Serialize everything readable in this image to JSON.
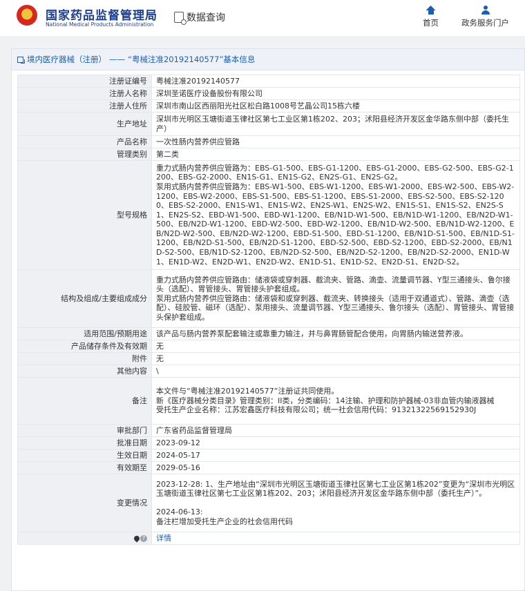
{
  "site": {
    "name_cn": "国家药品监督管理局",
    "name_en": "National Medical Products Administration",
    "query_label": "数据查询",
    "nav": {
      "home": "首页",
      "portal": "政务服务门户"
    }
  },
  "breadcrumb": {
    "category": "境内医疗器械（注册）",
    "separator": "——",
    "current": "“粤械注准20192140577”基本信息"
  },
  "rows": [
    {
      "key": "注册证编号",
      "lines": [
        "粤械注准20192140577"
      ]
    },
    {
      "key": "注册人名称",
      "lines": [
        "深圳圣诺医疗设备股份有限公司"
      ]
    },
    {
      "key": "注册人住所",
      "lines": [
        "深圳市南山区西丽阳光社区松白路1008号艺晶公司15栋六楼"
      ]
    },
    {
      "key": "生产地址",
      "lines": [
        "深圳市光明区玉塘街道玉律社区第七工业区第1栋202、203；沭阳县经济开发区金华路东侧中部（委托生产）"
      ]
    },
    {
      "key": "产品名称",
      "lines": [
        "一次性肠内营养供应管路"
      ]
    },
    {
      "key": "管理类别",
      "lines": [
        "第二类"
      ]
    },
    {
      "key": "型号规格",
      "lines": [
        "重力式肠内营养供应管路为：EBS-G1-500、EBS-G1-1200、EBS-G1-2000、EBS-G2-500、EBS-G2-1200、EBS-G2-2000、EN1S-G1、EN1S-G2、EN2S-G1、EN2S-G2。",
        "泵用式肠内营养供应管路为：EBS-W1-500、EBS-W1-1200、EBS-W1-2000、EBS-W2-500、EBS-W2-1200、EBS-W2-2000、EBS-S1-500、EBS-S1-1200、EBS-S1-2000、EBS-S2-500、EBS-S2-1200、EBS-S2-2000、EN1S-W1、EN1S-W2、EN2S-W1、EN2S-W2、EN1S-S1、EN1S-S2、EN2S-S1、EN2S-S2、EBD-W1-500、EBD-W1-1200、EB/N1D-W1-500、EB/N1D-W1-1200、EB/N2D-W1-500、EB/N2D-W1-1200、EBD-W2-500、EBD-W2-1200、EB/N1D-W2-500、EB/N1D-W2-1200、EB/N2D-W2-500、EB/N2D-W2-1200、EBD-S1-500、EBD-S1-1200、EB/N1D-S1-500、EB/N1D-S1-1200、EB/N2D-S1-500、EB/N2D-S1-1200、EBD-S2-500、EBD-S2-1200、EBD-S2-2000、EB/N1D-S2-500、EB/N1D-S2-1200、EB/N2D-S2-500、EB/N2D-S2-1200、EB/N2D-S2-2000、EN1D-W1、EN1D-W2、EN2D-W1、EN2D-W2、EN1D-S1、EN1D-S2、EN2D-S1、EN2D-S2。"
      ]
    },
    {
      "key": "结构及组成/主要组成成分",
      "lines": [
        "重力式肠内营养供应管路由：储液袋或穿刺器、截流夹、管路、滴壶、流量调节器、Y型三通接头、鲁尔接头（选配）、胃管接头、胃管接头护套组成。",
        "泵用式肠内营养供应管路由：储液袋和或穿刺器、截流夹、转换接头（适用于双通道式）、管路、滴壶（选配）、硅胶管、磁环（选配）、泵用接头、流量调节器、Y型三通接头、鲁尔接头（选配）、胃管接头、胃管接头保护套组成。"
      ]
    },
    {
      "key": "适用范围/预期用途",
      "lines": [
        "该产品与肠内营养泵配套输注或靠重力输注，并与鼻胃肠管配合使用，向胃肠内输送营养液。"
      ]
    },
    {
      "key": "产品储存条件及有效期",
      "lines": [
        "无"
      ]
    },
    {
      "key": "附件",
      "lines": [
        "无"
      ]
    },
    {
      "key": "其他内容",
      "lines": [
        "\\"
      ]
    },
    {
      "key": "备注",
      "lines": [
        "本文件与“粤械注准20192140577”注册证共同使用。",
        "新《医疗器械分类目录》管理类别：II类，分类编码：14注输、护理和防护器械-03非血管内输液器械",
        "受托生产企业名称：江苏宏鑫医疗科技有限公司；统一社会信用代码：91321322569152930J"
      ]
    },
    {
      "key": "审批部门",
      "lines": [
        "广东省药品监督管理局"
      ]
    },
    {
      "key": "批准日期",
      "lines": [
        "2023-09-12"
      ]
    },
    {
      "key": "生效日期",
      "lines": [
        "2024-05-17"
      ]
    },
    {
      "key": "有效期至",
      "lines": [
        "2029-05-16"
      ]
    },
    {
      "key": "变更情况",
      "lines": [
        "2023-12-28: 1、生产地址由“深圳市光明区玉塘街道玉律社区第七工业区第1栋202”变更为“深圳市光明区玉塘街道玉律社区第七工业区第1栋202、203；沭阳县经济开发区金华路东侧中部（委托生产）”。",
        "",
        "2024-06-13:",
        "备注栏增加受托生产企业的社会信用代码"
      ]
    }
  ],
  "footer_row": {
    "link": "详情"
  }
}
